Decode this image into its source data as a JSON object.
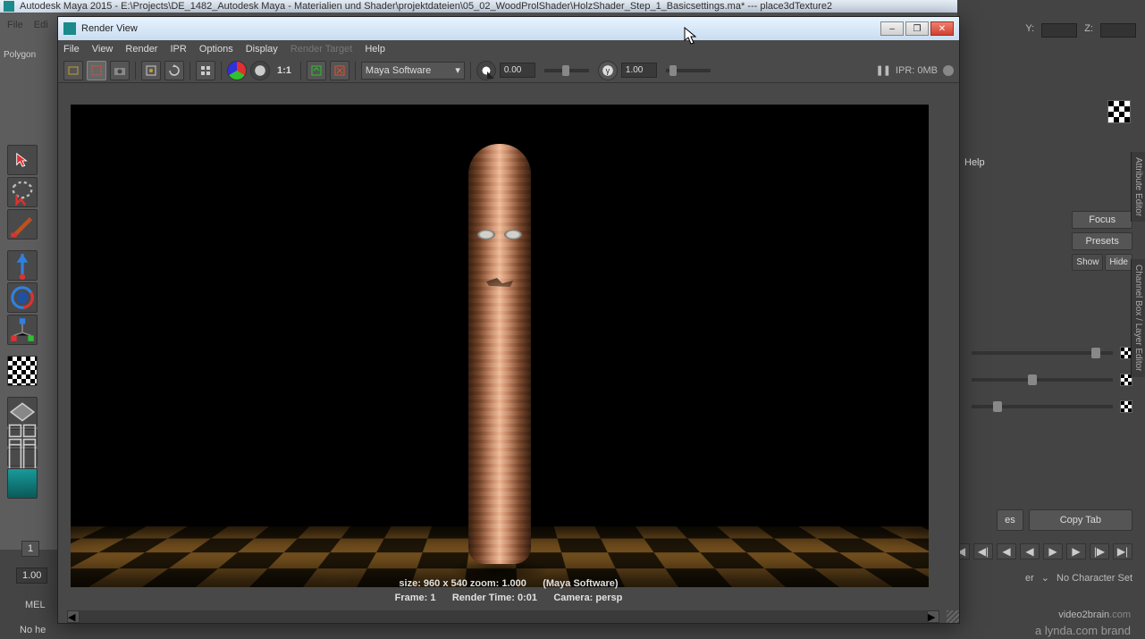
{
  "main_window": {
    "title": "Autodesk Maya 2015 - E:\\Projects\\DE_1482_Autodesk Maya - Materialien und Shader\\projektdateien\\05_02_WoodProlShader\\HolzShader_Step_1_Basicsettings.ma* --- place3dTexture2",
    "menu": {
      "file": "File",
      "edi": "Edi"
    },
    "shelf_tab": "Polygon",
    "win_controls": {
      "min": "–",
      "max": "❐",
      "close": "✕"
    }
  },
  "left_tools": {
    "select": "select-tool",
    "lasso": "lasso-tool",
    "paint": "paint-select-tool",
    "move": "move-tool",
    "rotate": "rotate-tool",
    "scale": "scale-tool",
    "uv": "uv-tool",
    "snap": "snap-tool",
    "grid1": "layout-single",
    "grid2": "layout-four",
    "grid3": "layout-two",
    "maya": "maya-button"
  },
  "bottom": {
    "frame_tick": "1",
    "frame_value": "1.00",
    "mel": "MEL",
    "status": "No he"
  },
  "right": {
    "coord_y": "Y:",
    "coord_z": "Z:",
    "help": "Help",
    "focus": "Focus",
    "presets": "Presets",
    "show": "Show",
    "hide": "Hide",
    "es_btn": "es",
    "copy_tab": "Copy Tab",
    "no_charset": "No Character Set",
    "side_tab1": "Attribute Editor",
    "side_tab2": "Channel Box / Layer Editor",
    "er_label": "er"
  },
  "render_view": {
    "title": "Render View",
    "menus": {
      "file": "File",
      "view": "View",
      "render": "Render",
      "ipr": "IPR",
      "options": "Options",
      "display": "Display",
      "render_target": "Render Target",
      "help": "Help"
    },
    "toolbar": {
      "scale_label": "1:1",
      "renderer": "Maya Software",
      "exposure_value": "0.00",
      "gamma_value": "1.00",
      "ipr_label": "IPR: 0MB"
    },
    "info": {
      "line1_size": "size: 960 x 540 zoom: 1.000",
      "line1_renderer": "(Maya Software)",
      "line2_frame": "Frame: 1",
      "line2_time": "Render Time: 0:01",
      "line2_cam": "Camera: persp"
    },
    "win_controls": {
      "min": "–",
      "max": "❐",
      "close": "✕"
    }
  },
  "watermark": {
    "brand": "video2brain",
    "tag": "a lynda.com brand"
  }
}
